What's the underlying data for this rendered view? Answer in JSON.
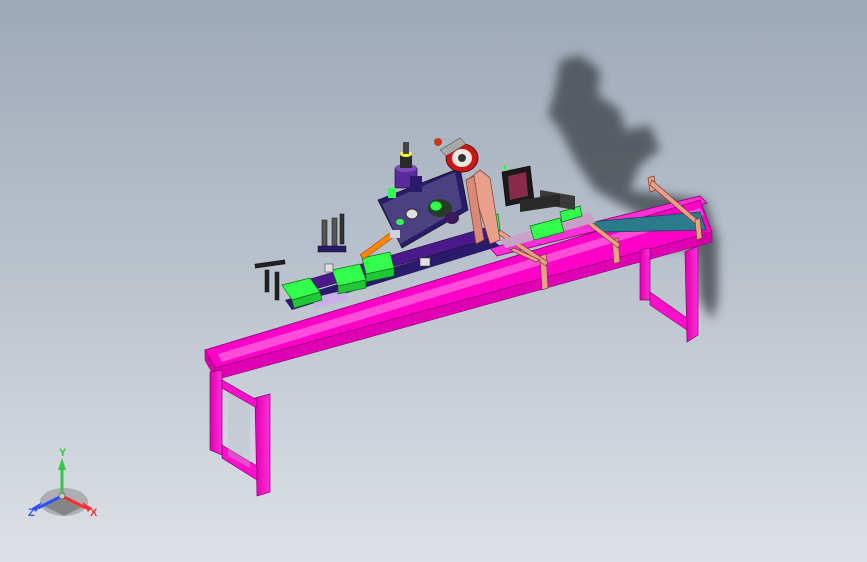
{
  "viewport": {
    "background_top": "#9ea9b8",
    "background_bottom": "#dde1e6"
  },
  "model": {
    "frame_color": "#ff00c8",
    "shadow_color": "#3a3f44",
    "component_colors": {
      "green": "#33ff4d",
      "salmon": "#e8a08c",
      "teal": "#2a7c8c",
      "purple": "#4a1a8a",
      "navy": "#2a1a6a",
      "orange": "#ff8800",
      "dark": "#222222"
    }
  },
  "triad": {
    "axes": [
      {
        "label": "Y",
        "color": "#2ecc40",
        "icon": "y-axis-arrow"
      },
      {
        "label": "X",
        "color": "#ff3030",
        "icon": "x-axis-arrow"
      },
      {
        "label": "Z",
        "color": "#3050ff",
        "icon": "z-axis-arrow"
      }
    ]
  }
}
